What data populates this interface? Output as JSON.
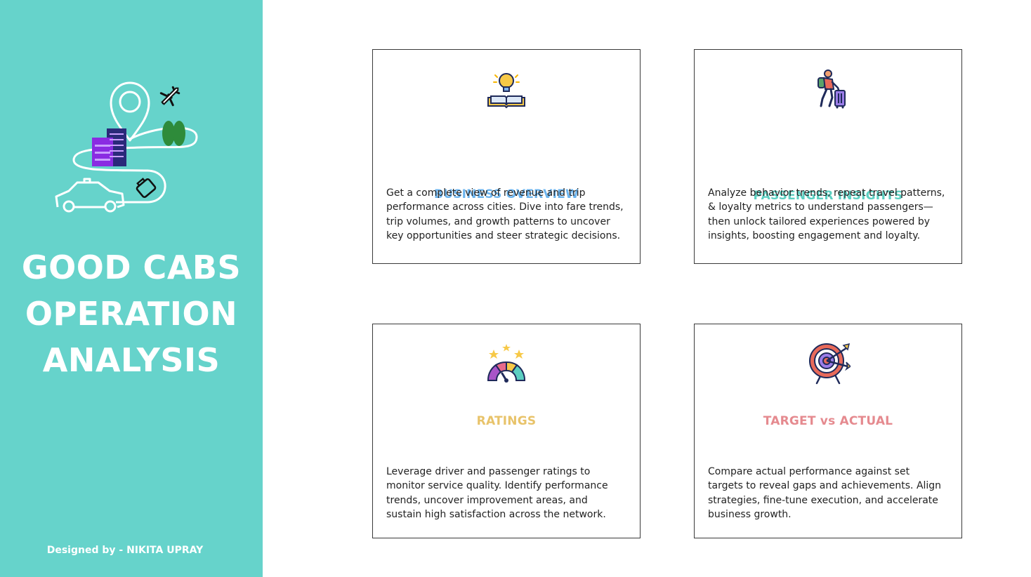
{
  "sidebar": {
    "title_lines": [
      "GOOD CABS",
      "OPERATION",
      "ANALYSIS"
    ],
    "credit": "Designed by - NIKITA UPRAY",
    "background_color": "#66d3cb"
  },
  "cards": [
    {
      "id": "business",
      "icon": "lightbulb-book-icon",
      "title": "BUSINESS OVERVIEW",
      "title_color": "#6cb4ee",
      "description": "Get a complete view of revenue and trip performance across cities. Dive into fare trends, trip volumes, and growth patterns to uncover key opportunities and steer strategic decisions."
    },
    {
      "id": "passenger",
      "icon": "traveler-luggage-icon",
      "title": "PASSENGER INSIGHTS",
      "title_color": "#5ccfc1",
      "description": "Analyze behavior trends, repeat travel patterns, & loyalty metrics to understand passengers—then unlock tailored experiences powered by insights, boosting engagement and loyalty."
    },
    {
      "id": "ratings",
      "icon": "rating-gauge-icon",
      "title": "RATINGS",
      "title_color": "#e8c36a",
      "description": "Leverage driver and passenger ratings to monitor service quality. Identify performance trends, uncover improvement areas, and sustain high satisfaction across the network."
    },
    {
      "id": "target",
      "icon": "target-arrows-icon",
      "title": "TARGET vs ACTUAL",
      "title_color": "#e58a8f",
      "description": "Compare actual performance against set targets to reveal gaps and achievements. Align strategies, fine-tune execution, and accelerate business growth."
    }
  ]
}
